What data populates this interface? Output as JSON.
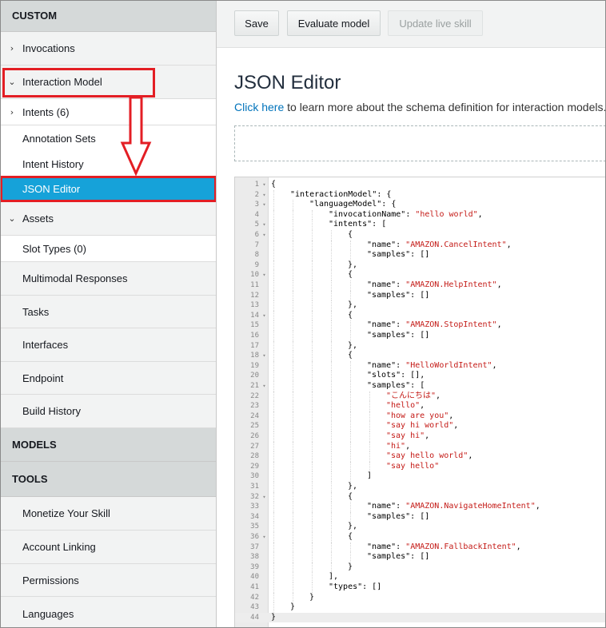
{
  "sidebar": {
    "section_custom": "CUSTOM",
    "invocations": "Invocations",
    "interaction_model": "Interaction Model",
    "intents": "Intents (6)",
    "annotation_sets": "Annotation Sets",
    "intent_history": "Intent History",
    "json_editor": "JSON Editor",
    "assets": "Assets",
    "slot_types": "Slot Types (0)",
    "multimodal": "Multimodal Responses",
    "tasks": "Tasks",
    "interfaces": "Interfaces",
    "endpoint": "Endpoint",
    "build_history": "Build History",
    "section_models": "MODELS",
    "section_tools": "TOOLS",
    "monetize": "Monetize Your Skill",
    "account_linking": "Account Linking",
    "permissions": "Permissions",
    "languages": "Languages",
    "chevron_right": "›",
    "chevron_down": "⌄"
  },
  "toolbar": {
    "save": "Save",
    "evaluate": "Evaluate model",
    "update_live": "Update live skill"
  },
  "main": {
    "title": "JSON Editor",
    "link_text": "Click here",
    "description_rest": " to learn more about the schema definition for interaction models."
  },
  "colors": {
    "accent": "#16a2d9",
    "highlight_red": "#e31e24",
    "link": "#0073bb",
    "string": "#c41a16"
  },
  "code": {
    "active_line": 44,
    "lines": [
      {
        "n": "1",
        "fold": true,
        "indent": 0,
        "parts": [
          [
            "p",
            "{"
          ]
        ]
      },
      {
        "n": "2",
        "fold": true,
        "indent": 1,
        "parts": [
          [
            "p",
            "\"interactionModel\": {"
          ]
        ]
      },
      {
        "n": "3",
        "fold": true,
        "indent": 2,
        "parts": [
          [
            "p",
            "\"languageModel\": {"
          ]
        ]
      },
      {
        "n": "4",
        "fold": false,
        "indent": 3,
        "parts": [
          [
            "p",
            "\"invocationName\": "
          ],
          [
            "s",
            "\"hello world\""
          ],
          [
            "p",
            ","
          ]
        ]
      },
      {
        "n": "5",
        "fold": true,
        "indent": 3,
        "parts": [
          [
            "p",
            "\"intents\": ["
          ]
        ]
      },
      {
        "n": "6",
        "fold": true,
        "indent": 4,
        "parts": [
          [
            "p",
            "{"
          ]
        ]
      },
      {
        "n": "7",
        "fold": false,
        "indent": 5,
        "parts": [
          [
            "p",
            "\"name\": "
          ],
          [
            "s",
            "\"AMAZON.CancelIntent\""
          ],
          [
            "p",
            ","
          ]
        ]
      },
      {
        "n": "8",
        "fold": false,
        "indent": 5,
        "parts": [
          [
            "p",
            "\"samples\": []"
          ]
        ]
      },
      {
        "n": "9",
        "fold": false,
        "indent": 4,
        "parts": [
          [
            "p",
            "},"
          ]
        ]
      },
      {
        "n": "10",
        "fold": true,
        "indent": 4,
        "parts": [
          [
            "p",
            "{"
          ]
        ]
      },
      {
        "n": "11",
        "fold": false,
        "indent": 5,
        "parts": [
          [
            "p",
            "\"name\": "
          ],
          [
            "s",
            "\"AMAZON.HelpIntent\""
          ],
          [
            "p",
            ","
          ]
        ]
      },
      {
        "n": "12",
        "fold": false,
        "indent": 5,
        "parts": [
          [
            "p",
            "\"samples\": []"
          ]
        ]
      },
      {
        "n": "13",
        "fold": false,
        "indent": 4,
        "parts": [
          [
            "p",
            "},"
          ]
        ]
      },
      {
        "n": "14",
        "fold": true,
        "indent": 4,
        "parts": [
          [
            "p",
            "{"
          ]
        ]
      },
      {
        "n": "15",
        "fold": false,
        "indent": 5,
        "parts": [
          [
            "p",
            "\"name\": "
          ],
          [
            "s",
            "\"AMAZON.StopIntent\""
          ],
          [
            "p",
            ","
          ]
        ]
      },
      {
        "n": "16",
        "fold": false,
        "indent": 5,
        "parts": [
          [
            "p",
            "\"samples\": []"
          ]
        ]
      },
      {
        "n": "17",
        "fold": false,
        "indent": 4,
        "parts": [
          [
            "p",
            "},"
          ]
        ]
      },
      {
        "n": "18",
        "fold": true,
        "indent": 4,
        "parts": [
          [
            "p",
            "{"
          ]
        ]
      },
      {
        "n": "19",
        "fold": false,
        "indent": 5,
        "parts": [
          [
            "p",
            "\"name\": "
          ],
          [
            "s",
            "\"HelloWorldIntent\""
          ],
          [
            "p",
            ","
          ]
        ]
      },
      {
        "n": "20",
        "fold": false,
        "indent": 5,
        "parts": [
          [
            "p",
            "\"slots\": [],"
          ]
        ]
      },
      {
        "n": "21",
        "fold": true,
        "indent": 5,
        "parts": [
          [
            "p",
            "\"samples\": ["
          ]
        ]
      },
      {
        "n": "22",
        "fold": false,
        "indent": 6,
        "parts": [
          [
            "s",
            "\"こんにちは\""
          ],
          [
            "p",
            ","
          ]
        ]
      },
      {
        "n": "23",
        "fold": false,
        "indent": 6,
        "parts": [
          [
            "s",
            "\"hello\""
          ],
          [
            "p",
            ","
          ]
        ]
      },
      {
        "n": "24",
        "fold": false,
        "indent": 6,
        "parts": [
          [
            "s",
            "\"how are you\""
          ],
          [
            "p",
            ","
          ]
        ]
      },
      {
        "n": "25",
        "fold": false,
        "indent": 6,
        "parts": [
          [
            "s",
            "\"say hi world\""
          ],
          [
            "p",
            ","
          ]
        ]
      },
      {
        "n": "26",
        "fold": false,
        "indent": 6,
        "parts": [
          [
            "s",
            "\"say hi\""
          ],
          [
            "p",
            ","
          ]
        ]
      },
      {
        "n": "27",
        "fold": false,
        "indent": 6,
        "parts": [
          [
            "s",
            "\"hi\""
          ],
          [
            "p",
            ","
          ]
        ]
      },
      {
        "n": "28",
        "fold": false,
        "indent": 6,
        "parts": [
          [
            "s",
            "\"say hello world\""
          ],
          [
            "p",
            ","
          ]
        ]
      },
      {
        "n": "29",
        "fold": false,
        "indent": 6,
        "parts": [
          [
            "s",
            "\"say hello\""
          ]
        ]
      },
      {
        "n": "30",
        "fold": false,
        "indent": 5,
        "parts": [
          [
            "p",
            "]"
          ]
        ]
      },
      {
        "n": "31",
        "fold": false,
        "indent": 4,
        "parts": [
          [
            "p",
            "},"
          ]
        ]
      },
      {
        "n": "32",
        "fold": true,
        "indent": 4,
        "parts": [
          [
            "p",
            "{"
          ]
        ]
      },
      {
        "n": "33",
        "fold": false,
        "indent": 5,
        "parts": [
          [
            "p",
            "\"name\": "
          ],
          [
            "s",
            "\"AMAZON.NavigateHomeIntent\""
          ],
          [
            "p",
            ","
          ]
        ]
      },
      {
        "n": "34",
        "fold": false,
        "indent": 5,
        "parts": [
          [
            "p",
            "\"samples\": []"
          ]
        ]
      },
      {
        "n": "35",
        "fold": false,
        "indent": 4,
        "parts": [
          [
            "p",
            "},"
          ]
        ]
      },
      {
        "n": "36",
        "fold": true,
        "indent": 4,
        "parts": [
          [
            "p",
            "{"
          ]
        ]
      },
      {
        "n": "37",
        "fold": false,
        "indent": 5,
        "parts": [
          [
            "p",
            "\"name\": "
          ],
          [
            "s",
            "\"AMAZON.FallbackIntent\""
          ],
          [
            "p",
            ","
          ]
        ]
      },
      {
        "n": "38",
        "fold": false,
        "indent": 5,
        "parts": [
          [
            "p",
            "\"samples\": []"
          ]
        ]
      },
      {
        "n": "39",
        "fold": false,
        "indent": 4,
        "parts": [
          [
            "p",
            "}"
          ]
        ]
      },
      {
        "n": "40",
        "fold": false,
        "indent": 3,
        "parts": [
          [
            "p",
            "],"
          ]
        ]
      },
      {
        "n": "41",
        "fold": false,
        "indent": 3,
        "parts": [
          [
            "p",
            "\"types\": []"
          ]
        ]
      },
      {
        "n": "42",
        "fold": false,
        "indent": 2,
        "parts": [
          [
            "p",
            "}"
          ]
        ]
      },
      {
        "n": "43",
        "fold": false,
        "indent": 1,
        "parts": [
          [
            "p",
            "}"
          ]
        ]
      },
      {
        "n": "44",
        "fold": false,
        "indent": 0,
        "parts": [
          [
            "p",
            "}"
          ]
        ]
      }
    ]
  }
}
